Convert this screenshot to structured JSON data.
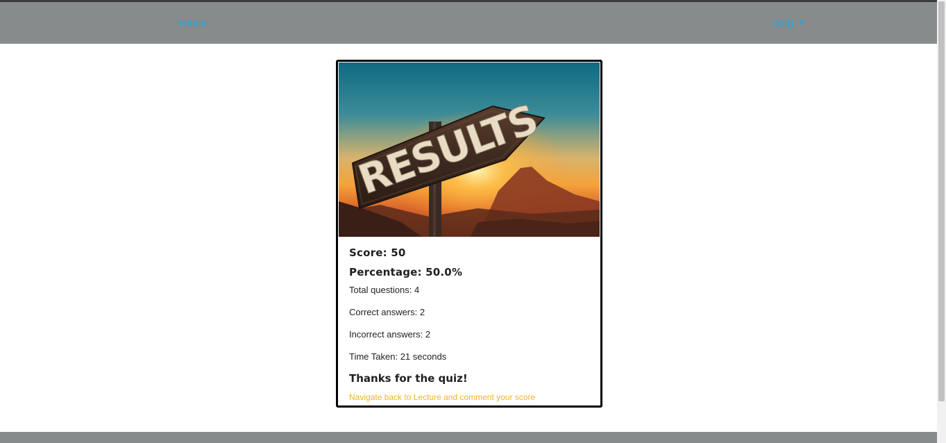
{
  "nav": {
    "home_label": "Home",
    "user_label": "cody"
  },
  "colors": {
    "navbar": "#878b8c",
    "link": "#1fa7e8",
    "accent_link": "#f0b429"
  },
  "image": {
    "sign_text": "RESULTS"
  },
  "results": {
    "score": "Score: 50",
    "percentage": "Percentage: 50.0%",
    "total_questions": "Total questions: 4",
    "correct_answers": "Correct answers: 2",
    "incorrect_answers": "Incorrect answers: 2",
    "time_taken": "Time Taken: 21 seconds",
    "thanks": "Thanks for the quiz!",
    "back_link": "Navigate back to Lecture and comment your score"
  }
}
